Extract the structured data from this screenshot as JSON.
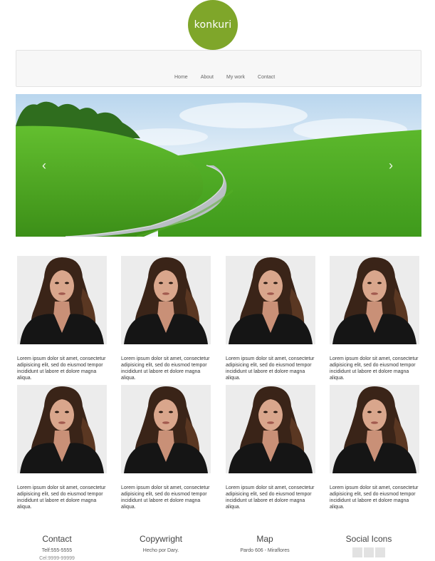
{
  "logo": {
    "text": "konkuri",
    "color": "#7fa62a"
  },
  "nav": {
    "items": [
      "Home",
      "About",
      "My work",
      "Contact"
    ]
  },
  "carousel": {
    "prev_icon": "chevron-left-icon",
    "next_icon": "chevron-right-icon",
    "prev_glyph": "‹",
    "next_glyph": "›"
  },
  "cards": [
    {
      "text": "Lorem ipsum dolor sit amet, consectetur adipisicing elit, sed do eiusmod tempor incididunt ut labore et dolore magna aliqua."
    },
    {
      "text": "Lorem ipsum dolor sit amet, consectetur adipisicing elit, sed do eiusmod tempor incididunt ut labore et dolore magna aliqua."
    },
    {
      "text": "Lorem ipsum dolor sit amet, consectetur adipisicing elit, sed do eiusmod tempor incididunt ut labore et dolore magna aliqua."
    },
    {
      "text": "Lorem ipsum dolor sit amet, consectetur adipisicing elit, sed do eiusmod tempor incididunt ut labore et dolore magna aliqua."
    },
    {
      "text": "Lorem ipsum dolor sit amet, consectetur adipisicing elit, sed do eiusmod tempor incididunt ut labore et dolore magna aliqua."
    },
    {
      "text": "Lorem ipsum dolor sit amet, consectetur adipisicing elit, sed do eiusmod tempor incididunt ut labore et dolore magna aliqua."
    },
    {
      "text": "Lorem ipsum dolor sit amet, consectetur adipisicing elit, sed do eiusmod tempor incididunt ut labore et dolore magna aliqua."
    },
    {
      "text": "Lorem ipsum dolor sit amet, consectetur adipisicing elit, sed do eiusmod tempor incididunt ut labore et dolore magna aliqua."
    }
  ],
  "footer": {
    "contact": {
      "heading": "Contact",
      "line1": "Telf:555-5555",
      "line2": "Cel:9999-99999"
    },
    "copyright": {
      "heading": "Copywright",
      "line1": "Hecho por Dary."
    },
    "map": {
      "heading": "Map",
      "line1": "Pardo 606 - Miraflores"
    },
    "social": {
      "heading": "Social Icons"
    }
  }
}
